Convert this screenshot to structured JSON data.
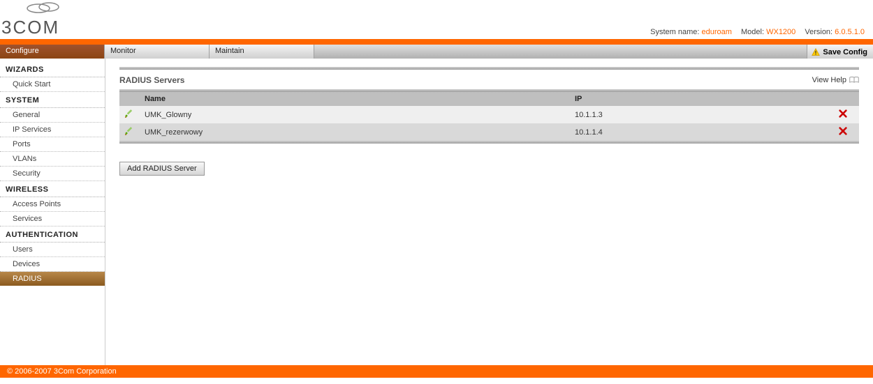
{
  "header": {
    "system_name_label": "System name:",
    "system_name_value": "eduroam",
    "model_label": "Model:",
    "model_value": "WX1200",
    "version_label": "Version:",
    "version_value": "6.0.5.1.0"
  },
  "tabs": {
    "configure": "Configure",
    "monitor": "Monitor",
    "maintain": "Maintain",
    "save_config": "Save Config"
  },
  "sidebar": {
    "groups": [
      {
        "title": "WIZARDS",
        "items": [
          "Quick Start"
        ]
      },
      {
        "title": "SYSTEM",
        "items": [
          "General",
          "IP Services",
          "Ports",
          "VLANs",
          "Security"
        ]
      },
      {
        "title": "WIRELESS",
        "items": [
          "Access Points",
          "Services"
        ]
      },
      {
        "title": "AUTHENTICATION",
        "items": [
          "Users",
          "Devices",
          "RADIUS"
        ]
      }
    ],
    "selected": "RADIUS"
  },
  "panel": {
    "title": "RADIUS Servers",
    "view_help": "View Help",
    "columns": {
      "name": "Name",
      "ip": "IP"
    },
    "rows": [
      {
        "name": "UMK_Glowny",
        "ip": "10.1.1.3"
      },
      {
        "name": "UMK_rezerwowy",
        "ip": "10.1.1.4"
      }
    ],
    "add_button": "Add RADIUS Server"
  },
  "footer": {
    "copyright": "© 2006-2007 3Com Corporation"
  }
}
